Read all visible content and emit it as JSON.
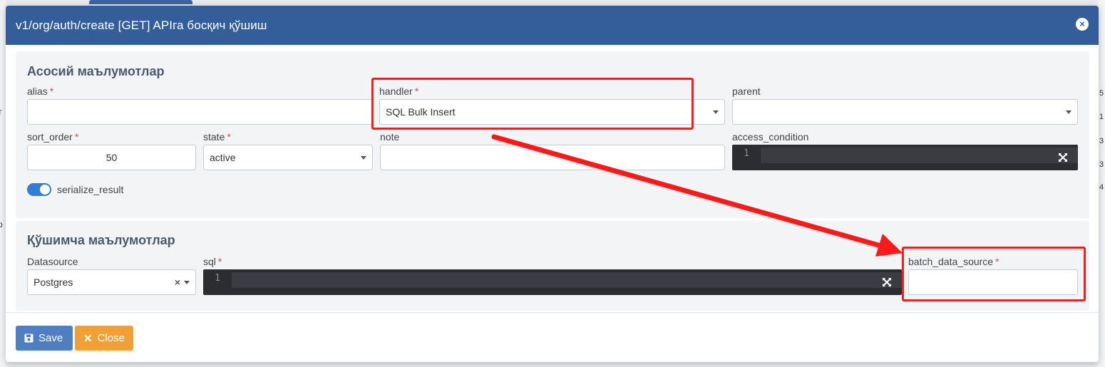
{
  "modal": {
    "title": "v1/org/auth/create [GET] APIга босқич қўшиш",
    "close_icon": "×"
  },
  "section_main": {
    "title": "Асосий маълумотлар",
    "alias": {
      "label": "alias",
      "required": "*",
      "value": ""
    },
    "handler": {
      "label": "handler",
      "required": "*",
      "value": "SQL Bulk Insert"
    },
    "parent": {
      "label": "parent",
      "value": ""
    },
    "sort_order": {
      "label": "sort_order",
      "required": "*",
      "value": "50"
    },
    "state": {
      "label": "state",
      "required": "*",
      "value": "active"
    },
    "note": {
      "label": "note",
      "value": ""
    },
    "access_condition": {
      "label": "access_condition",
      "line_number": "1"
    },
    "serialize_result": {
      "label": "serialize_result",
      "checked": true
    }
  },
  "section_extra": {
    "title": "Қўшимча маълумотлар",
    "datasource": {
      "label": "Datasource",
      "value": "Postgres",
      "clear": "×"
    },
    "sql": {
      "label": "sql",
      "required": "*",
      "line_number": "1"
    },
    "batch_data_source": {
      "label": "batch_data_source",
      "required": "*",
      "value": ""
    }
  },
  "footer": {
    "save_label": "Save",
    "close_label": "Close",
    "close_icon": "✕"
  },
  "colors": {
    "header": "#335e99",
    "save": "#4f7fc2",
    "close": "#f0a035",
    "annotation": "#ff1a1a",
    "toggle": "#2f7fd8"
  },
  "background": {
    "right_digits": [
      "5",
      "1",
      "3",
      "3",
      "4"
    ],
    "left_chars": [
      "т",
      "р"
    ]
  }
}
